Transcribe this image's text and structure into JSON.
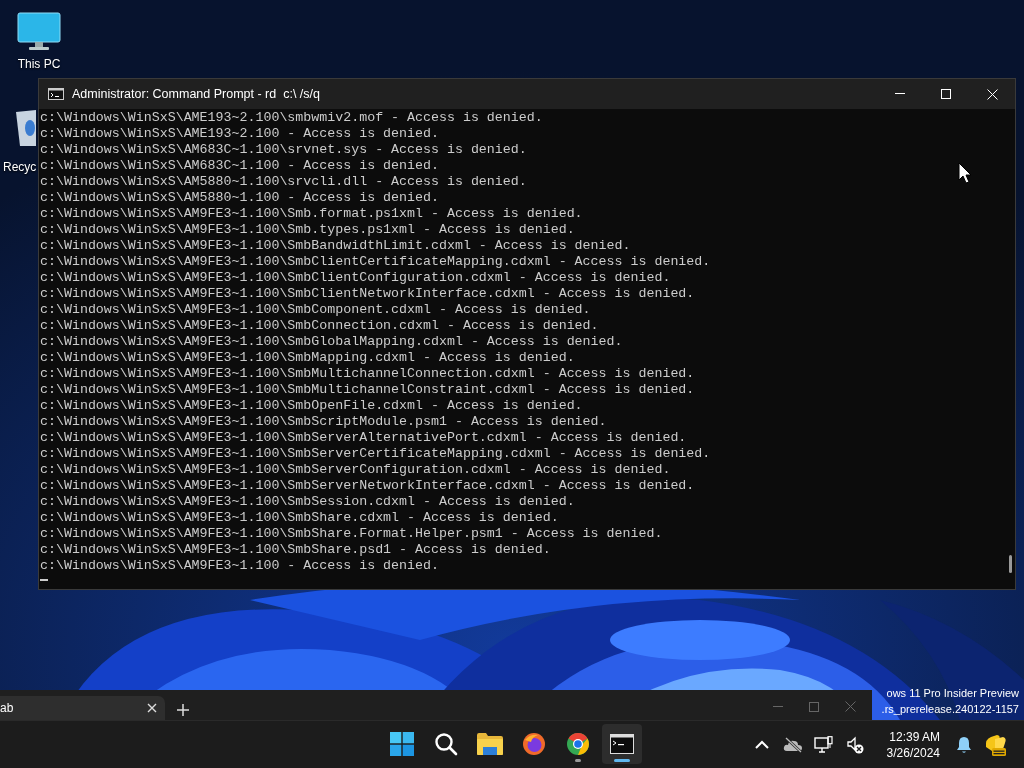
{
  "desktop_icons": [
    {
      "kind": "computer",
      "label": "This PC"
    },
    {
      "kind": "recycle",
      "label": "Recyc"
    }
  ],
  "window": {
    "title": "Administrator: Command Prompt - rd  c:\\ /s/q",
    "lines": [
      "c:\\Windows\\WinSxS\\AME193~2.100\\smbwmiv2.mof - Access is denied.",
      "c:\\Windows\\WinSxS\\AME193~2.100 - Access is denied.",
      "c:\\Windows\\WinSxS\\AM683C~1.100\\srvnet.sys - Access is denied.",
      "c:\\Windows\\WinSxS\\AM683C~1.100 - Access is denied.",
      "c:\\Windows\\WinSxS\\AM5880~1.100\\srvcli.dll - Access is denied.",
      "c:\\Windows\\WinSxS\\AM5880~1.100 - Access is denied.",
      "c:\\Windows\\WinSxS\\AM9FE3~1.100\\Smb.format.ps1xml - Access is denied.",
      "c:\\Windows\\WinSxS\\AM9FE3~1.100\\Smb.types.ps1xml - Access is denied.",
      "c:\\Windows\\WinSxS\\AM9FE3~1.100\\SmbBandwidthLimit.cdxml - Access is denied.",
      "c:\\Windows\\WinSxS\\AM9FE3~1.100\\SmbClientCertificateMapping.cdxml - Access is denied.",
      "c:\\Windows\\WinSxS\\AM9FE3~1.100\\SmbClientConfiguration.cdxml - Access is denied.",
      "c:\\Windows\\WinSxS\\AM9FE3~1.100\\SmbClientNetworkInterface.cdxml - Access is denied.",
      "c:\\Windows\\WinSxS\\AM9FE3~1.100\\SmbComponent.cdxml - Access is denied.",
      "c:\\Windows\\WinSxS\\AM9FE3~1.100\\SmbConnection.cdxml - Access is denied.",
      "c:\\Windows\\WinSxS\\AM9FE3~1.100\\SmbGlobalMapping.cdxml - Access is denied.",
      "c:\\Windows\\WinSxS\\AM9FE3~1.100\\SmbMapping.cdxml - Access is denied.",
      "c:\\Windows\\WinSxS\\AM9FE3~1.100\\SmbMultichannelConnection.cdxml - Access is denied.",
      "c:\\Windows\\WinSxS\\AM9FE3~1.100\\SmbMultichannelConstraint.cdxml - Access is denied.",
      "c:\\Windows\\WinSxS\\AM9FE3~1.100\\SmbOpenFile.cdxml - Access is denied.",
      "c:\\Windows\\WinSxS\\AM9FE3~1.100\\SmbScriptModule.psm1 - Access is denied.",
      "c:\\Windows\\WinSxS\\AM9FE3~1.100\\SmbServerAlternativePort.cdxml - Access is denied.",
      "c:\\Windows\\WinSxS\\AM9FE3~1.100\\SmbServerCertificateMapping.cdxml - Access is denied.",
      "c:\\Windows\\WinSxS\\AM9FE3~1.100\\SmbServerConfiguration.cdxml - Access is denied.",
      "c:\\Windows\\WinSxS\\AM9FE3~1.100\\SmbServerNetworkInterface.cdxml - Access is denied.",
      "c:\\Windows\\WinSxS\\AM9FE3~1.100\\SmbSession.cdxml - Access is denied.",
      "c:\\Windows\\WinSxS\\AM9FE3~1.100\\SmbShare.cdxml - Access is denied.",
      "c:\\Windows\\WinSxS\\AM9FE3~1.100\\SmbShare.Format.Helper.psm1 - Access is denied.",
      "c:\\Windows\\WinSxS\\AM9FE3~1.100\\SmbShare.psd1 - Access is denied.",
      "c:\\Windows\\WinSxS\\AM9FE3~1.100 - Access is denied."
    ]
  },
  "background_window": {
    "tab": "ab"
  },
  "watermark": [
    "ows 11 Pro Insider Preview",
    ".rs_prerelease.240122-1157"
  ],
  "taskbar": {
    "items": [
      {
        "kind": "start",
        "running": false,
        "active": false
      },
      {
        "kind": "search",
        "running": false,
        "active": false
      },
      {
        "kind": "folder",
        "running": false,
        "active": false
      },
      {
        "kind": "firefox",
        "running": false,
        "active": false
      },
      {
        "kind": "chrome",
        "running": true,
        "active": false
      },
      {
        "kind": "terminal",
        "running": true,
        "active": true
      }
    ],
    "tray": [
      {
        "kind": "chevron"
      },
      {
        "kind": "cloud-off"
      },
      {
        "kind": "network"
      },
      {
        "kind": "volume-muted"
      }
    ],
    "clock": {
      "time": "12:39 AM",
      "date": "3/26/2024"
    },
    "notifications": {
      "kind": "bell"
    },
    "extra": {
      "kind": "pre-badge"
    }
  }
}
